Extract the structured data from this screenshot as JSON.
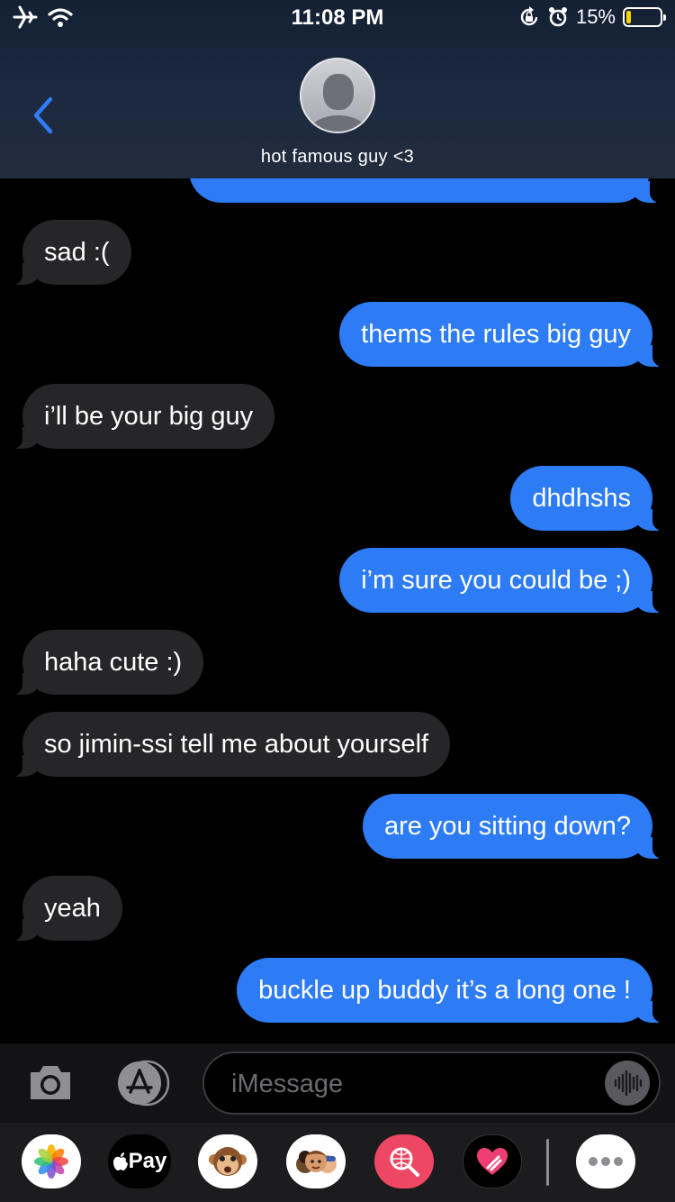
{
  "status_bar": {
    "time": "11:08 PM",
    "battery_percent": "15%",
    "battery_level": 0.15,
    "icons": [
      "airplane-icon",
      "wifi-icon",
      "rotation-lock-icon",
      "alarm-icon",
      "battery-icon"
    ]
  },
  "header": {
    "contact_name": "hot famous guy <3",
    "back_icon": "chevron-left-icon",
    "avatar_icon": "person-silhouette-icon"
  },
  "messages": [
    {
      "side": "in",
      "text": "sad :("
    },
    {
      "side": "out",
      "text": "thems the rules big guy"
    },
    {
      "side": "in",
      "text": "i’ll be your big guy"
    },
    {
      "side": "out",
      "text": "dhdhshs"
    },
    {
      "side": "out",
      "text": "i’m sure you could be ;)"
    },
    {
      "side": "in",
      "text": "haha cute :)"
    },
    {
      "side": "in",
      "text": "so jimin-ssi tell me about yourself"
    },
    {
      "side": "out",
      "text": "are you sitting down?"
    },
    {
      "side": "in",
      "text": "yeah"
    },
    {
      "side": "out",
      "text": "buckle up buddy it’s a long one !"
    }
  ],
  "input_bar": {
    "placeholder": "iMessage",
    "icons": [
      "camera-icon",
      "app-store-icon",
      "audio-waveform-icon"
    ]
  },
  "app_drawer": {
    "apple_pay_label": "Pay",
    "apps": [
      "photos-app-icon",
      "apple-pay-icon",
      "monkey-memoji-icon",
      "memoji-stickers-icon",
      "web-search-icon",
      "digital-touch-icon",
      "more-apps-icon"
    ]
  },
  "colors": {
    "outgoing_bubble": "#2d7cf6",
    "incoming_bubble": "#262628",
    "accent": "#2f7cf6",
    "battery_fill": "#f5d400"
  }
}
